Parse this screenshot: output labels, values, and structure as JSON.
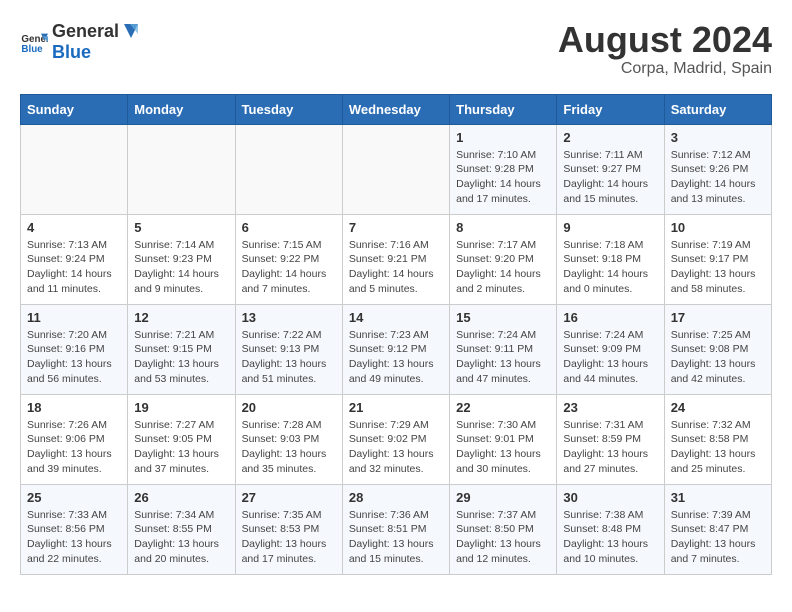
{
  "header": {
    "logo_general": "General",
    "logo_blue": "Blue",
    "month_year": "August 2024",
    "location": "Corpa, Madrid, Spain"
  },
  "days_of_week": [
    "Sunday",
    "Monday",
    "Tuesday",
    "Wednesday",
    "Thursday",
    "Friday",
    "Saturday"
  ],
  "weeks": [
    [
      {
        "day": "",
        "info": ""
      },
      {
        "day": "",
        "info": ""
      },
      {
        "day": "",
        "info": ""
      },
      {
        "day": "",
        "info": ""
      },
      {
        "day": "1",
        "info": "Sunrise: 7:10 AM\nSunset: 9:28 PM\nDaylight: 14 hours and 17 minutes."
      },
      {
        "day": "2",
        "info": "Sunrise: 7:11 AM\nSunset: 9:27 PM\nDaylight: 14 hours and 15 minutes."
      },
      {
        "day": "3",
        "info": "Sunrise: 7:12 AM\nSunset: 9:26 PM\nDaylight: 14 hours and 13 minutes."
      }
    ],
    [
      {
        "day": "4",
        "info": "Sunrise: 7:13 AM\nSunset: 9:24 PM\nDaylight: 14 hours and 11 minutes."
      },
      {
        "day": "5",
        "info": "Sunrise: 7:14 AM\nSunset: 9:23 PM\nDaylight: 14 hours and 9 minutes."
      },
      {
        "day": "6",
        "info": "Sunrise: 7:15 AM\nSunset: 9:22 PM\nDaylight: 14 hours and 7 minutes."
      },
      {
        "day": "7",
        "info": "Sunrise: 7:16 AM\nSunset: 9:21 PM\nDaylight: 14 hours and 5 minutes."
      },
      {
        "day": "8",
        "info": "Sunrise: 7:17 AM\nSunset: 9:20 PM\nDaylight: 14 hours and 2 minutes."
      },
      {
        "day": "9",
        "info": "Sunrise: 7:18 AM\nSunset: 9:18 PM\nDaylight: 14 hours and 0 minutes."
      },
      {
        "day": "10",
        "info": "Sunrise: 7:19 AM\nSunset: 9:17 PM\nDaylight: 13 hours and 58 minutes."
      }
    ],
    [
      {
        "day": "11",
        "info": "Sunrise: 7:20 AM\nSunset: 9:16 PM\nDaylight: 13 hours and 56 minutes."
      },
      {
        "day": "12",
        "info": "Sunrise: 7:21 AM\nSunset: 9:15 PM\nDaylight: 13 hours and 53 minutes."
      },
      {
        "day": "13",
        "info": "Sunrise: 7:22 AM\nSunset: 9:13 PM\nDaylight: 13 hours and 51 minutes."
      },
      {
        "day": "14",
        "info": "Sunrise: 7:23 AM\nSunset: 9:12 PM\nDaylight: 13 hours and 49 minutes."
      },
      {
        "day": "15",
        "info": "Sunrise: 7:24 AM\nSunset: 9:11 PM\nDaylight: 13 hours and 47 minutes."
      },
      {
        "day": "16",
        "info": "Sunrise: 7:24 AM\nSunset: 9:09 PM\nDaylight: 13 hours and 44 minutes."
      },
      {
        "day": "17",
        "info": "Sunrise: 7:25 AM\nSunset: 9:08 PM\nDaylight: 13 hours and 42 minutes."
      }
    ],
    [
      {
        "day": "18",
        "info": "Sunrise: 7:26 AM\nSunset: 9:06 PM\nDaylight: 13 hours and 39 minutes."
      },
      {
        "day": "19",
        "info": "Sunrise: 7:27 AM\nSunset: 9:05 PM\nDaylight: 13 hours and 37 minutes."
      },
      {
        "day": "20",
        "info": "Sunrise: 7:28 AM\nSunset: 9:03 PM\nDaylight: 13 hours and 35 minutes."
      },
      {
        "day": "21",
        "info": "Sunrise: 7:29 AM\nSunset: 9:02 PM\nDaylight: 13 hours and 32 minutes."
      },
      {
        "day": "22",
        "info": "Sunrise: 7:30 AM\nSunset: 9:01 PM\nDaylight: 13 hours and 30 minutes."
      },
      {
        "day": "23",
        "info": "Sunrise: 7:31 AM\nSunset: 8:59 PM\nDaylight: 13 hours and 27 minutes."
      },
      {
        "day": "24",
        "info": "Sunrise: 7:32 AM\nSunset: 8:58 PM\nDaylight: 13 hours and 25 minutes."
      }
    ],
    [
      {
        "day": "25",
        "info": "Sunrise: 7:33 AM\nSunset: 8:56 PM\nDaylight: 13 hours and 22 minutes."
      },
      {
        "day": "26",
        "info": "Sunrise: 7:34 AM\nSunset: 8:55 PM\nDaylight: 13 hours and 20 minutes."
      },
      {
        "day": "27",
        "info": "Sunrise: 7:35 AM\nSunset: 8:53 PM\nDaylight: 13 hours and 17 minutes."
      },
      {
        "day": "28",
        "info": "Sunrise: 7:36 AM\nSunset: 8:51 PM\nDaylight: 13 hours and 15 minutes."
      },
      {
        "day": "29",
        "info": "Sunrise: 7:37 AM\nSunset: 8:50 PM\nDaylight: 13 hours and 12 minutes."
      },
      {
        "day": "30",
        "info": "Sunrise: 7:38 AM\nSunset: 8:48 PM\nDaylight: 13 hours and 10 minutes."
      },
      {
        "day": "31",
        "info": "Sunrise: 7:39 AM\nSunset: 8:47 PM\nDaylight: 13 hours and 7 minutes."
      }
    ]
  ]
}
